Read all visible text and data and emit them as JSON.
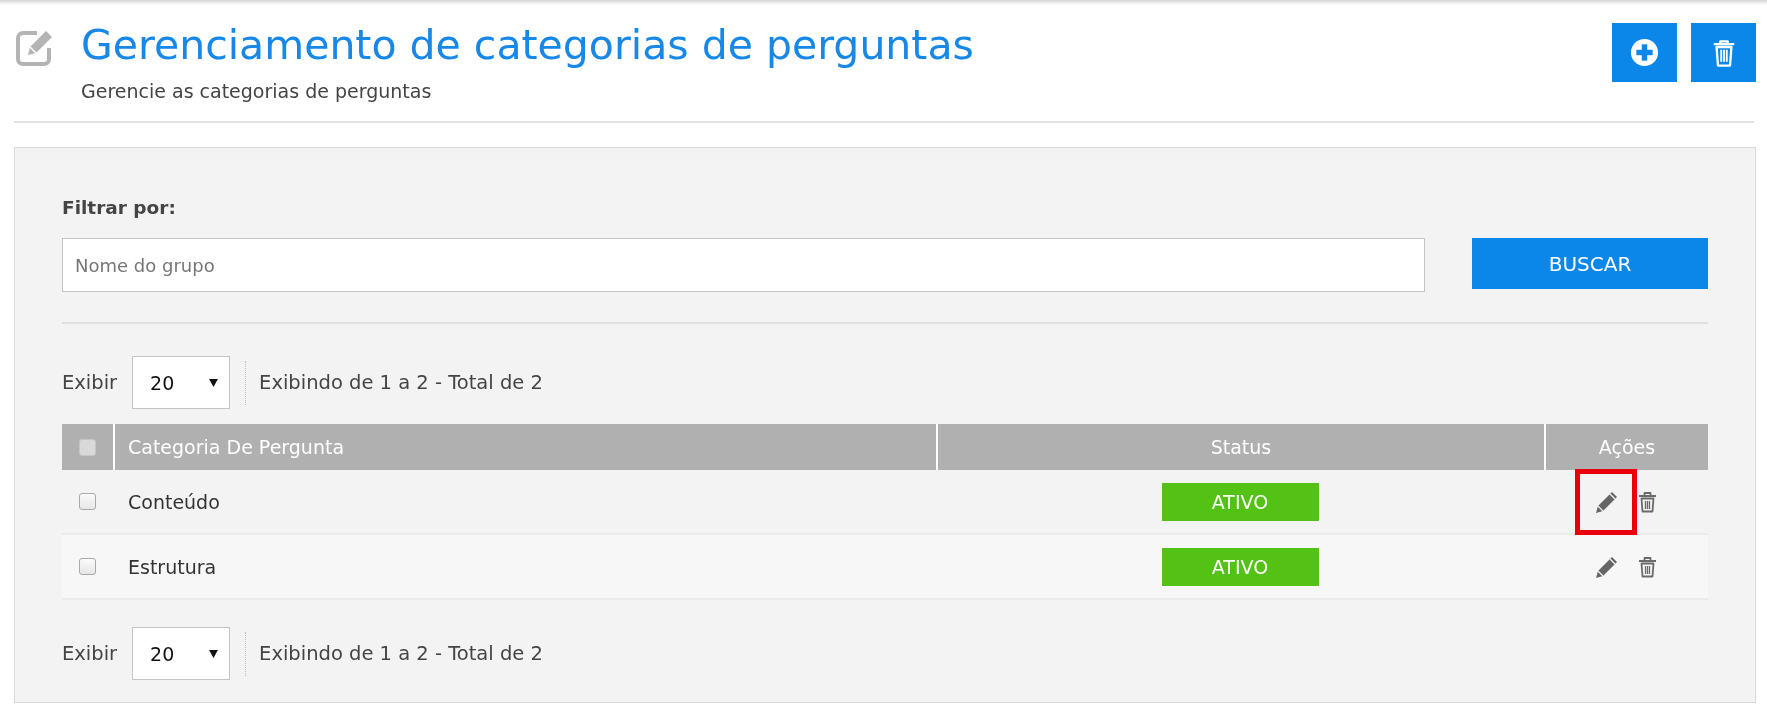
{
  "header": {
    "title": "Gerenciamento de categorias de perguntas",
    "subtitle": "Gerencie as categorias de perguntas"
  },
  "filter": {
    "label": "Filtrar por:",
    "placeholder": "Nome do grupo",
    "button": "BUSCAR"
  },
  "pager_top": {
    "label": "Exibir",
    "page_size": "20",
    "summary": "Exibindo de 1 a 2 - Total de 2"
  },
  "table": {
    "select_all_checked": false,
    "columns": [
      "Categoria De Pergunta",
      "Status",
      "Ações"
    ],
    "rows": [
      {
        "checked": false,
        "category": "Conteúdo",
        "status": {
          "label": "ATIVO",
          "color": "#54c214"
        },
        "edit_highlighted": true
      },
      {
        "checked": false,
        "category": "Estrutura",
        "status": {
          "label": "ATIVO",
          "color": "#54c214"
        },
        "edit_highlighted": false
      }
    ]
  },
  "pager_bottom": {
    "label": "Exibir",
    "page_size": "20",
    "summary": "Exibindo de 1 a 2 - Total de 2"
  }
}
